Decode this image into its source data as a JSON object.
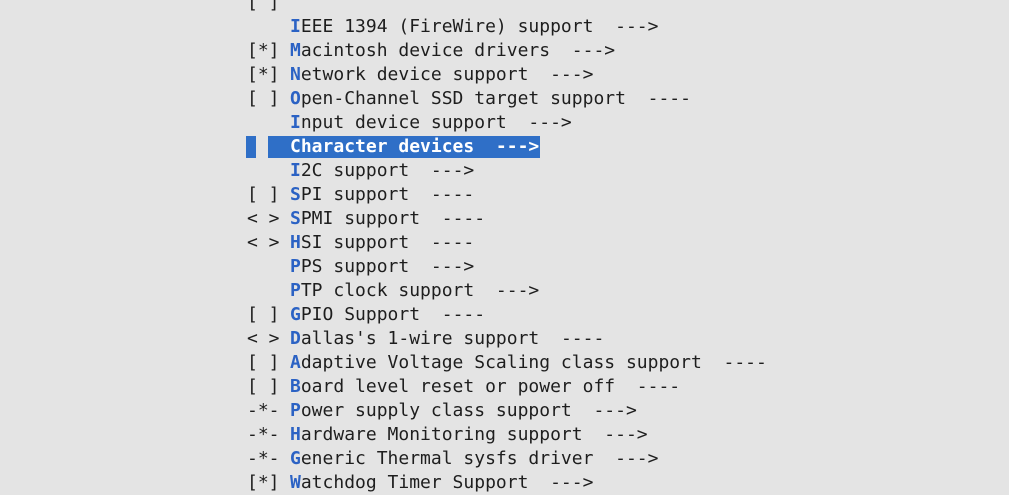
{
  "menu": {
    "items": [
      {
        "prefix": "[ ]",
        "hot": "",
        "rest": "",
        "suffix": "",
        "selected": false
      },
      {
        "prefix": "   ",
        "hot": "I",
        "rest": "EEE 1394 (FireWire) support",
        "suffix": "  --->",
        "selected": false
      },
      {
        "prefix": "[*]",
        "hot": "M",
        "rest": "acintosh device drivers",
        "suffix": "  --->",
        "selected": false
      },
      {
        "prefix": "[*]",
        "hot": "N",
        "rest": "etwork device support",
        "suffix": "  --->",
        "selected": false
      },
      {
        "prefix": "[ ]",
        "hot": "O",
        "rest": "pen-Channel SSD target support",
        "suffix": "  ----",
        "selected": false
      },
      {
        "prefix": "   ",
        "hot": "I",
        "rest": "nput device support",
        "suffix": "  --->",
        "selected": false
      },
      {
        "prefix": "   ",
        "hot": "C",
        "rest": "haracter devices",
        "suffix": "  --->",
        "selected": true
      },
      {
        "prefix": "   ",
        "hot": "I",
        "rest": "2C support",
        "suffix": "  --->",
        "selected": false
      },
      {
        "prefix": "[ ]",
        "hot": "S",
        "rest": "PI support",
        "suffix": "  ----",
        "selected": false
      },
      {
        "prefix": "< >",
        "hot": "S",
        "rest": "PMI support",
        "suffix": "  ----",
        "selected": false
      },
      {
        "prefix": "< >",
        "hot": "H",
        "rest": "SI support",
        "suffix": "  ----",
        "selected": false
      },
      {
        "prefix": "   ",
        "hot": "P",
        "rest": "PS support",
        "suffix": "  --->",
        "selected": false
      },
      {
        "prefix": "   ",
        "hot": "P",
        "rest": "TP clock support",
        "suffix": "  --->",
        "selected": false
      },
      {
        "prefix": "[ ]",
        "hot": "G",
        "rest": "PIO Support",
        "suffix": "  ----",
        "selected": false
      },
      {
        "prefix": "< >",
        "hot": "D",
        "rest": "allas's 1-wire support",
        "suffix": "  ----",
        "selected": false
      },
      {
        "prefix": "[ ]",
        "hot": "A",
        "rest": "daptive Voltage Scaling class support",
        "suffix": "  ----",
        "selected": false
      },
      {
        "prefix": "[ ]",
        "hot": "B",
        "rest": "oard level reset or power off",
        "suffix": "  ----",
        "selected": false
      },
      {
        "prefix": "-*-",
        "hot": "P",
        "rest": "ower supply class support",
        "suffix": "  --->",
        "selected": false
      },
      {
        "prefix": "-*-",
        "hot": "H",
        "rest": "ardware Monitoring support",
        "suffix": "  --->",
        "selected": false
      },
      {
        "prefix": "-*-",
        "hot": "G",
        "rest": "eneric Thermal sysfs driver",
        "suffix": "  --->",
        "selected": false
      },
      {
        "prefix": "[*]",
        "hot": "W",
        "rest": "atchdog Timer Support",
        "suffix": "  --->",
        "selected": false
      }
    ]
  },
  "colors": {
    "background": "#e4e4e4",
    "text": "#1e1e1e",
    "hotkey": "#2b62c4",
    "selection": "#2f6fc7",
    "selection_text": "#ffffff"
  }
}
